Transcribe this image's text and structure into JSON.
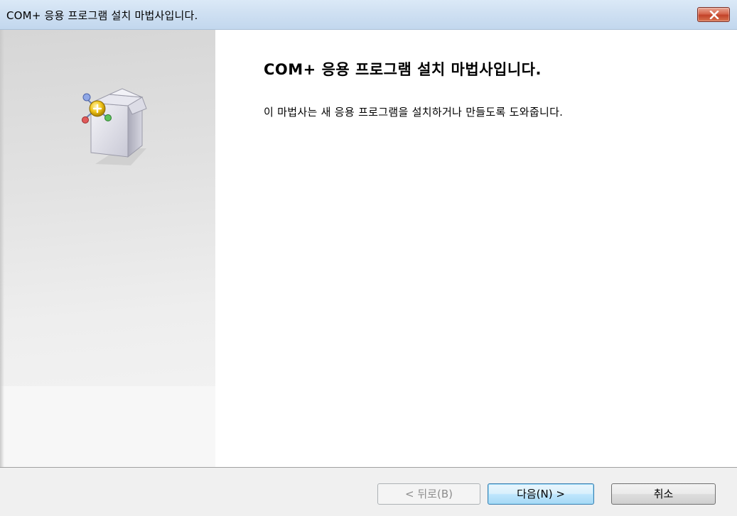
{
  "window": {
    "title": "COM+ 응용 프로그램 설치 마법사입니다."
  },
  "main": {
    "heading": "COM+ 응용 프로그램 설치 마법사입니다.",
    "description": "이 마법사는 새 응용 프로그램을 설치하거나 만들도록 도와줍니다."
  },
  "footer": {
    "back_label": "< 뒤로(B)",
    "next_label": "다음(N) >",
    "cancel_label": "취소"
  },
  "icons": {
    "close": "close-icon",
    "wizard": "com-package-icon"
  },
  "colors": {
    "close_button": "#c94a31",
    "default_button_border": "#3c7fb1",
    "titlebar": "#cfe0f2"
  }
}
